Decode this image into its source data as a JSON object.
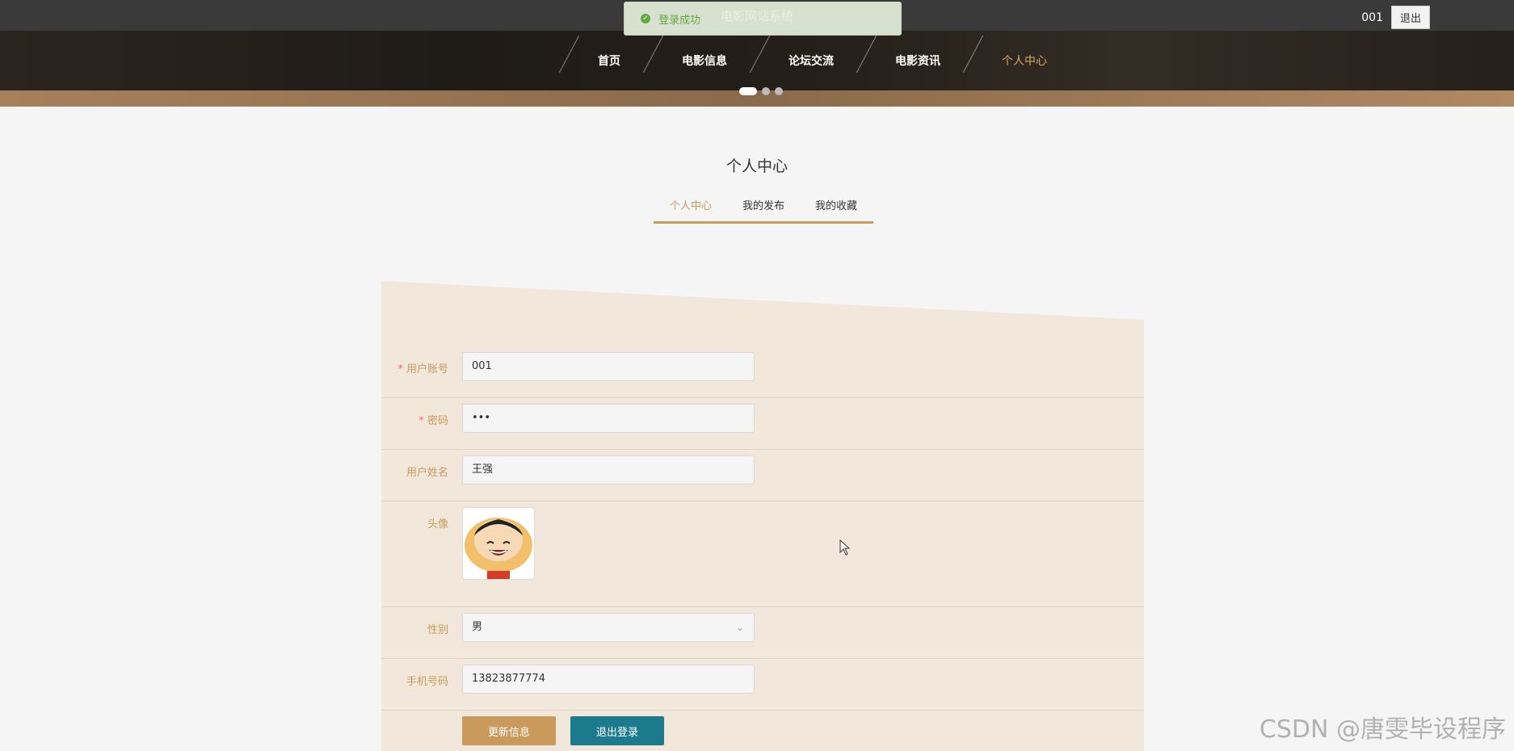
{
  "header": {
    "site_title": "电影网站系统",
    "username": "001",
    "logout_label": "退出"
  },
  "toast": {
    "message": "登录成功",
    "icon": "check-circle-icon"
  },
  "nav": {
    "items": [
      {
        "label": "首页",
        "active": false
      },
      {
        "label": "电影信息",
        "active": false
      },
      {
        "label": "论坛交流",
        "active": false
      },
      {
        "label": "电影资讯",
        "active": false
      },
      {
        "label": "个人中心",
        "active": true
      }
    ],
    "carousel_dots": 3,
    "carousel_active": 0
  },
  "page": {
    "title": "个人中心",
    "tabs": [
      {
        "label": "个人中心",
        "active": true
      },
      {
        "label": "我的发布",
        "active": false
      },
      {
        "label": "我的收藏",
        "active": false
      }
    ]
  },
  "form": {
    "account": {
      "label": "用户账号",
      "required": true,
      "value": "001"
    },
    "password": {
      "label": "密码",
      "required": true,
      "value": "•••"
    },
    "name": {
      "label": "用户姓名",
      "value": "王强"
    },
    "avatar": {
      "label": "头像"
    },
    "gender": {
      "label": "性别",
      "value": "男"
    },
    "phone": {
      "label": "手机号码",
      "value": "13823877774"
    },
    "update_label": "更新信息",
    "logout_label": "退出登录"
  },
  "watermark": "CSDN @唐雯毕设程序",
  "colors": {
    "accent": "#c99a5b",
    "teal": "#1b7a8c",
    "panel": "#f1e7db",
    "topbar": "#3a3a3a"
  }
}
